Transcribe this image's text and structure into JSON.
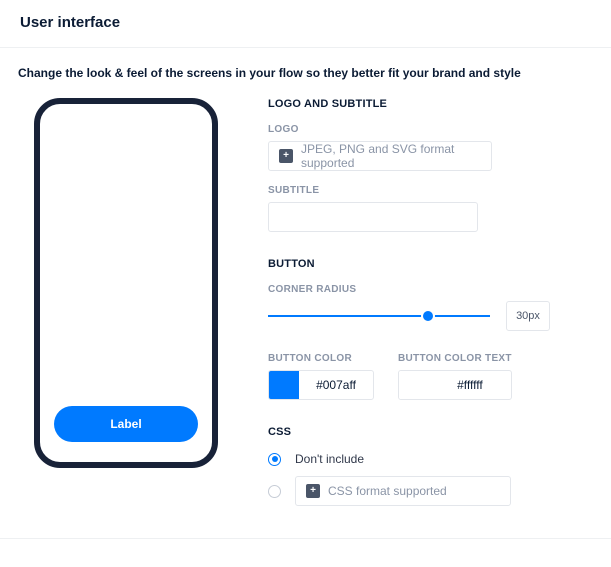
{
  "header": {
    "title": "User interface"
  },
  "description": "Change the look & feel of the screens in your flow so they better fit your brand and style",
  "preview": {
    "button_label": "Label"
  },
  "sections": {
    "logo_subtitle": {
      "title": "LOGO AND SUBTITLE",
      "logo": {
        "label": "LOGO",
        "placeholder": "JPEG, PNG and SVG format supported"
      },
      "subtitle": {
        "label": "SUBTITLE",
        "value": ""
      }
    },
    "button": {
      "title": "BUTTON",
      "corner_radius": {
        "label": "CORNER RADIUS",
        "value": "30px"
      },
      "button_color": {
        "label": "BUTTON COLOR",
        "value": "#007aff"
      },
      "button_color_text": {
        "label": "BUTTON COLOR TEXT",
        "value": "#ffffff"
      }
    },
    "css": {
      "title": "CSS",
      "options": {
        "dont_include": {
          "label": "Don't include",
          "selected": true
        },
        "upload": {
          "placeholder": "CSS format supported",
          "selected": false
        }
      }
    }
  }
}
